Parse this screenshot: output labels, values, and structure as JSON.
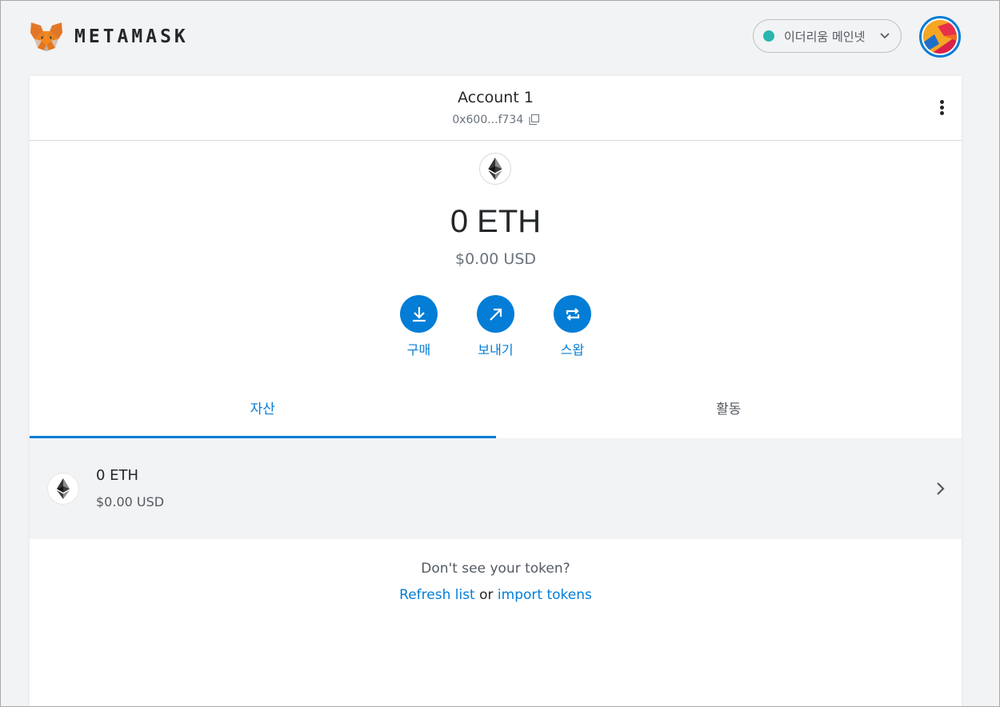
{
  "header": {
    "brand": "METAMASK",
    "network": {
      "label": "이더리움 메인넷",
      "status_color": "#29b6af"
    }
  },
  "account": {
    "name": "Account 1",
    "address": "0x600...f734"
  },
  "balance": {
    "primary": "0 ETH",
    "secondary": "$0.00 USD"
  },
  "actions": {
    "buy": "구매",
    "send": "보내기",
    "swap": "스왑"
  },
  "tabs": {
    "assets": "자산",
    "activity": "활동"
  },
  "assets": [
    {
      "amount": "0 ETH",
      "fiat": "$0.00 USD"
    }
  ],
  "footer": {
    "prompt": "Don't see your token?",
    "refresh": "Refresh list",
    "or": "or",
    "import": "import tokens"
  },
  "colors": {
    "accent": "#037dd6",
    "background": "#f2f3f4"
  }
}
